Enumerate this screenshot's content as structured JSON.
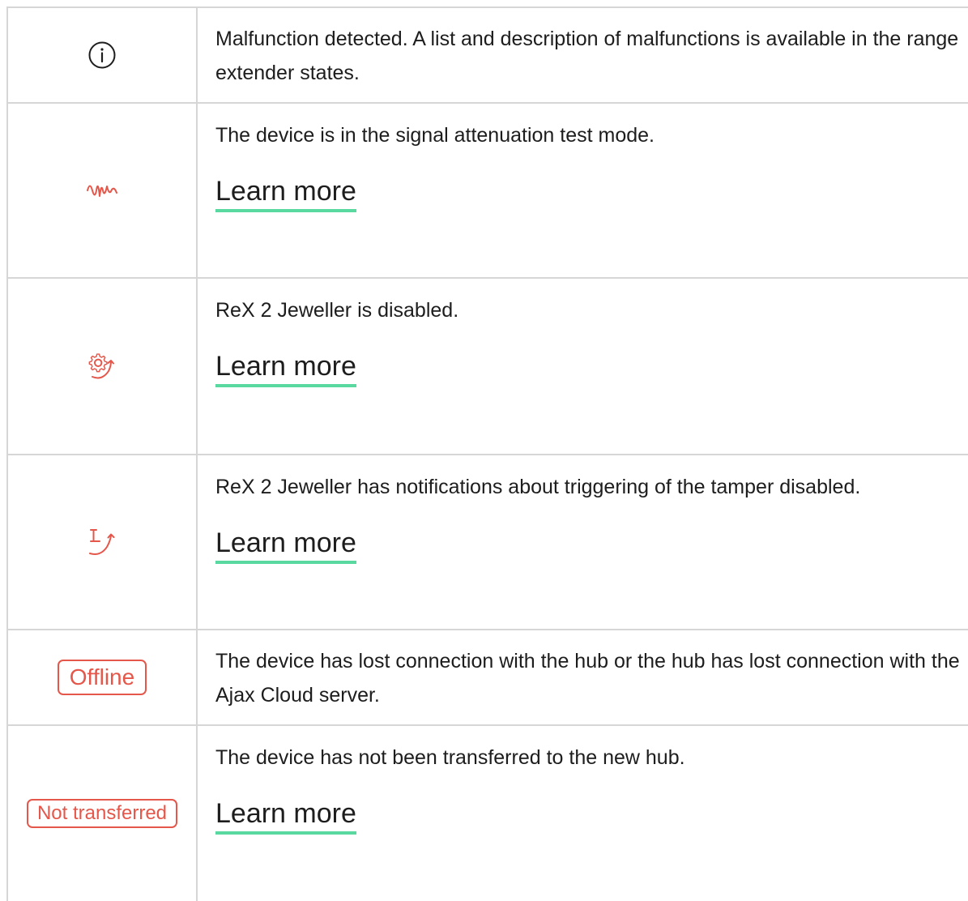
{
  "rows": [
    {
      "icon": "info-circle-icon",
      "description": "Malfunction detected. A list and description of malfunctions is available in the range extender states."
    },
    {
      "icon": "signal-wave-icon",
      "description": "The device is in the signal attenuation test mode.",
      "link": "Learn more"
    },
    {
      "icon": "gear-disabled-icon",
      "description": "ReX 2 Jeweller is disabled.",
      "link": "Learn more"
    },
    {
      "icon": "tamper-disabled-icon",
      "description": "ReX 2 Jeweller has notifications about triggering of the tamper disabled.",
      "link": "Learn more"
    },
    {
      "badge": "Offline",
      "description": "The device has lost connection with the hub or the hub has lost connection with the Ajax Cloud server."
    },
    {
      "badge": "Not transferred",
      "description": "The device has not been transferred to the new hub.",
      "link": "Learn more"
    }
  ],
  "colors": {
    "accent_red": "#e4574a",
    "link_underline": "#59d9a0",
    "border": "#d6d6d6",
    "text": "#1d1d1d"
  }
}
